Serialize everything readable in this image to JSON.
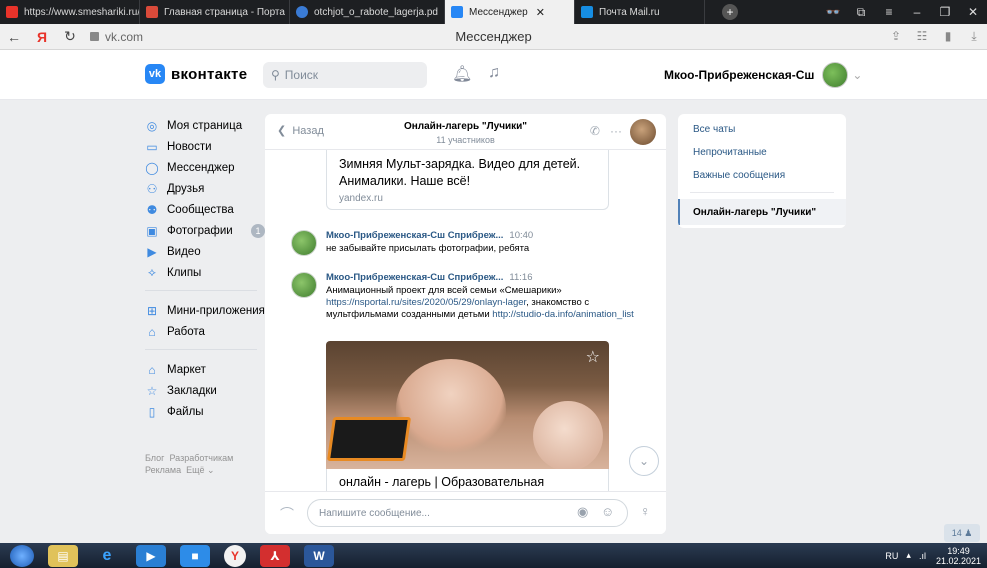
{
  "browser": {
    "tabs": [
      {
        "label": "https://www.smeshariki.ru/",
        "color": "#e8332a"
      },
      {
        "label": "Главная страница - Порта",
        "color": "#d94a3a"
      },
      {
        "label": "otchjot_o_rabote_lagerja.pd",
        "color": "#3a7bd5"
      },
      {
        "label": "Мессенджер",
        "color": "#2787f5"
      },
      {
        "label": "Почта Mail.ru",
        "color": "#168de2"
      }
    ],
    "url": "vk.com",
    "page_title": "Мессенджер"
  },
  "header": {
    "logo_badge": "vk",
    "logo_text": "вконтакте",
    "search_placeholder": "Поиск",
    "user_name": "Мкоо-Прибреженская-Сш"
  },
  "menu": {
    "items": [
      {
        "label": "Моя страница",
        "icon": "user-circle-icon"
      },
      {
        "label": "Новости",
        "icon": "news-icon"
      },
      {
        "label": "Мессенджер",
        "icon": "message-icon"
      },
      {
        "label": "Друзья",
        "icon": "friends-icon"
      },
      {
        "label": "Сообщества",
        "icon": "groups-icon"
      },
      {
        "label": "Фотографии",
        "icon": "photo-icon",
        "badge": "1"
      },
      {
        "label": "Видео",
        "icon": "video-icon"
      },
      {
        "label": "Клипы",
        "icon": "clips-icon"
      }
    ],
    "items2": [
      {
        "label": "Мини-приложения",
        "icon": "apps-icon"
      },
      {
        "label": "Работа",
        "icon": "work-icon"
      }
    ],
    "items3": [
      {
        "label": "Маркет",
        "icon": "market-icon"
      },
      {
        "label": "Закладки",
        "icon": "bookmark-icon"
      },
      {
        "label": "Файлы",
        "icon": "files-icon"
      }
    ],
    "footer": [
      "Блог",
      "Разработчикам",
      "Реклама",
      "Ещё"
    ]
  },
  "chat": {
    "back_label": "Назад",
    "title": "Онлайн-лагерь \"Лучики\"",
    "members": "11 участников",
    "link_card": {
      "title": "Зимняя Мульт-зарядка. Видео для детей. Анималики. Наше всё!",
      "source": "yandex.ru"
    },
    "messages": [
      {
        "author": "Мкоо-Прибреженская-Сш Сприбреж...",
        "time": "10:40",
        "text": "не забывайте присылать фотографии, ребята"
      },
      {
        "author": "Мкоо-Прибреженская-Сш Сприбреж...",
        "time": "11:16",
        "text_before": "Анимационный проект для всей семьи «Смешарики»",
        "link1": "https://nsportal.ru/sites/2020/05/29/onlayn-lager",
        "text_mid": ", знакомство с мультфильмами созданными детьми",
        "link2": "http://studio-da.info/animation_list"
      }
    ],
    "photo_caption": "онлайн - лагерь | Образовательная",
    "composer_placeholder": "Напишите сообщение..."
  },
  "right_panel": {
    "items": [
      "Все чаты",
      "Непрочитанные",
      "Важные сообщения"
    ],
    "active": "Онлайн-лагерь \"Лучики\""
  },
  "online_badge": "14",
  "taskbar": {
    "lang": "RU",
    "time": "19:49",
    "date": "21.02.2021"
  }
}
